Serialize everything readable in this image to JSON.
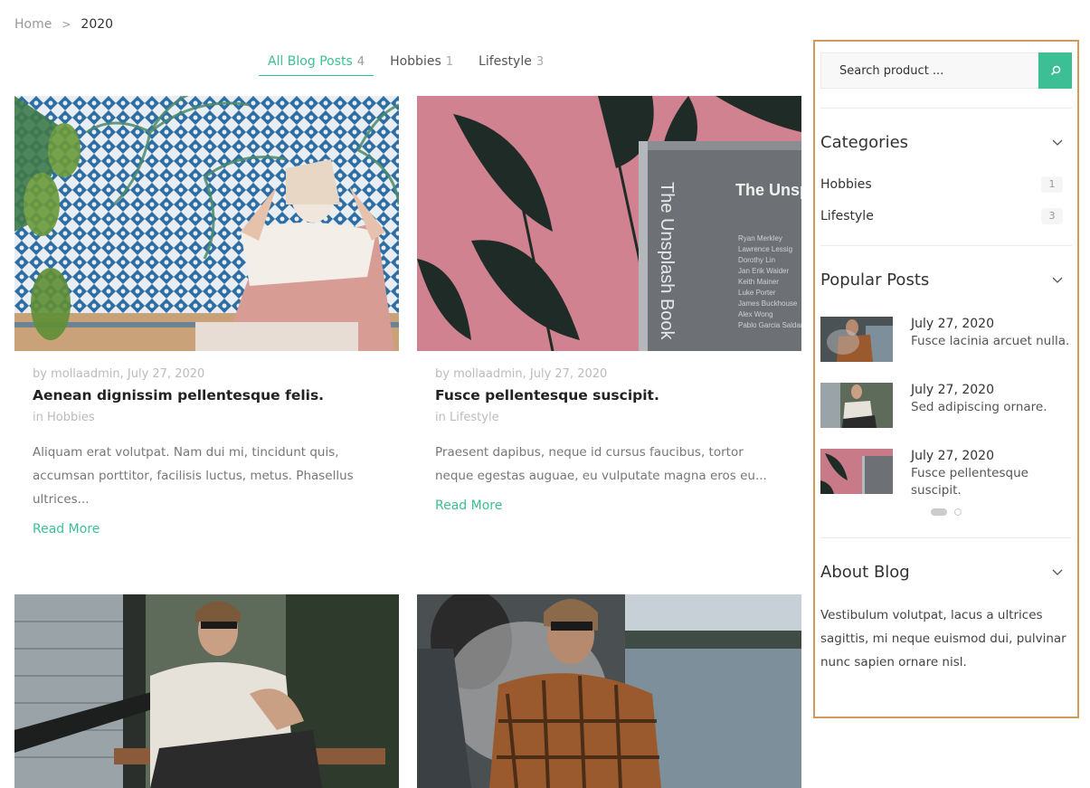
{
  "breadcrumb": {
    "home": "Home",
    "separator": ">",
    "current": "2020"
  },
  "tabs": [
    {
      "label": "All Blog Posts",
      "count": "4"
    },
    {
      "label": "Hobbies",
      "count": "1"
    },
    {
      "label": "Lifestyle",
      "count": "3"
    }
  ],
  "posts": [
    {
      "meta": "by mollaadmin, July 27, 2020",
      "title": "Aenean dignissim pellentesque felis.",
      "category": "in Hobbies",
      "excerpt": "Aliquam erat volutpat. Nam dui mi, tincidunt quis, accumsan porttitor, facilisis luctus, metus. Phasellus ultrices...",
      "read_more": "Read More"
    },
    {
      "meta": "by mollaadmin, July 27, 2020",
      "title": "Fusce pellentesque suscipit.",
      "category": "in Lifestyle",
      "excerpt": "Praesent dapibus, neque id cursus faucibus, tortor neque egestas auguae, eu vulputate magna eros eu...",
      "read_more": "Read More"
    }
  ],
  "sidebar": {
    "search_placeholder": "Search product ...",
    "categories": {
      "title": "Categories",
      "items": [
        {
          "label": "Hobbies",
          "count": "1"
        },
        {
          "label": "Lifestyle",
          "count": "3"
        }
      ]
    },
    "popular": {
      "title": "Popular Posts",
      "items": [
        {
          "date": "July 27, 2020",
          "title": "Fusce lacinia arcuet nulla."
        },
        {
          "date": "July 27, 2020",
          "title": "Sed adipiscing ornare."
        },
        {
          "date": "July 27, 2020",
          "title": "Fusce pellentesque suscipit."
        }
      ]
    },
    "about": {
      "title": "About Blog",
      "text": "Vestibulum volutpat, lacus a ultrices sagittis, mi neque euismod dui, pulvinar nunc sapien ornare nisl."
    }
  },
  "colors": {
    "accent": "#3dbf95",
    "highlight_border": "#d29a5a"
  }
}
